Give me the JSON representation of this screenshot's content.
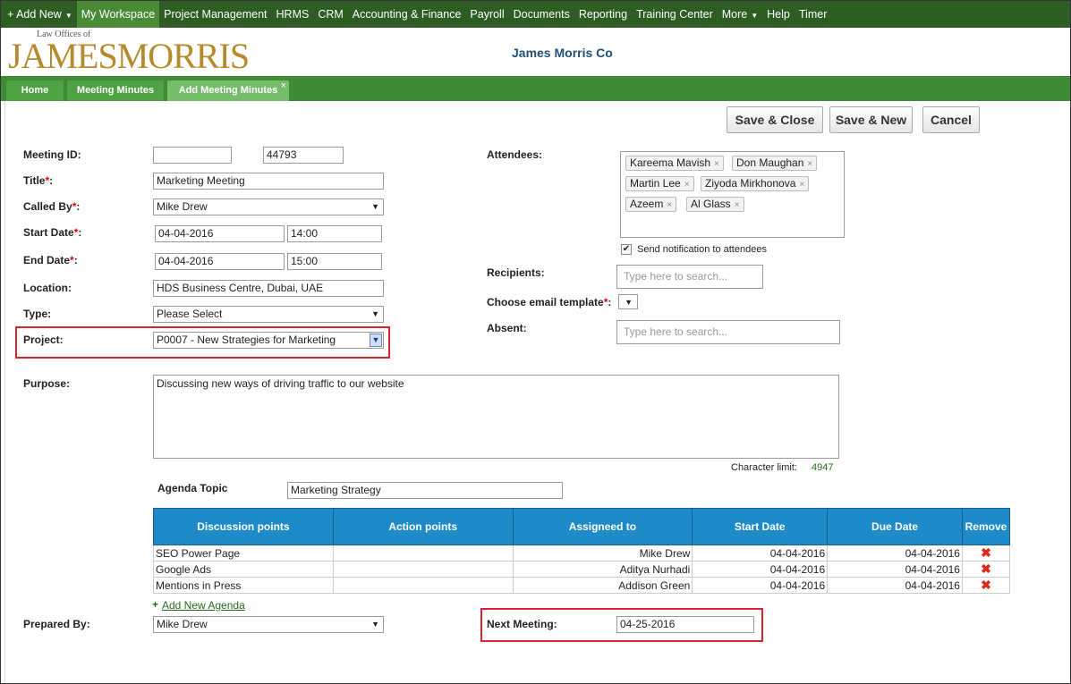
{
  "topnav": {
    "add_new": "+ Add New",
    "items": [
      "My Workspace",
      "Project Management",
      "HRMS",
      "CRM",
      "Accounting & Finance",
      "Payroll",
      "Documents",
      "Reporting",
      "Training Center"
    ],
    "more": "More",
    "help": "Help",
    "timer": "Timer"
  },
  "header": {
    "logo_small": "Law Offices of",
    "logo_big": "JAMESMORRIS",
    "company": "James Morris Co"
  },
  "tabs": [
    "Home",
    "Meeting Minutes",
    "Add Meeting Minutes"
  ],
  "tab_close": "×",
  "actions": {
    "save_close": "Save & Close",
    "save_new": "Save & New",
    "cancel": "Cancel"
  },
  "form": {
    "meeting_id_label": "Meeting ID:",
    "meeting_id_value": "",
    "meeting_id_number": "44793",
    "title_label": "Title",
    "title_value": "Marketing Meeting",
    "called_by_label": "Called By",
    "called_by_value": "Mike Drew",
    "start_date_label": "Start Date",
    "start_date_value": "04-04-2016",
    "start_time_value": "14:00",
    "end_date_label": "End Date",
    "end_date_value": "04-04-2016",
    "end_time_value": "15:00",
    "location_label": "Location:",
    "location_value": "HDS Business Centre, Dubai, UAE",
    "type_label": "Type:",
    "type_value": "Please Select",
    "project_label": "Project:",
    "project_value": "P0007 - New Strategies for Marketing",
    "purpose_label": "Purpose:",
    "purpose_value": "Discussing new ways of driving traffic to our website",
    "char_limit_label": "Character limit:",
    "char_limit_value": "4947",
    "agenda_topic_label": "Agenda Topic",
    "agenda_topic_value": "Marketing Strategy",
    "prepared_by_label": "Prepared By:",
    "prepared_by_value": "Mike Drew",
    "next_meeting_label": "Next Meeting:",
    "next_meeting_value": "04-25-2016",
    "required_mark": "*",
    "colon": ":"
  },
  "right": {
    "attendees_label": "Attendees:",
    "attendees": [
      "Kareema Mavish",
      "Don Maughan",
      "Martin Lee",
      "Ziyoda Mirkhonova",
      "Azeem",
      "Al Glass"
    ],
    "tag_remove": "×",
    "send_notification": "Send notification to attendees",
    "checkbox_mark": "✔",
    "recipients_label": "Recipients:",
    "recipients_placeholder": "Type here to search...",
    "email_template_label": "Choose email template",
    "absent_label": "Absent:",
    "absent_placeholder": "Type here to search..."
  },
  "agenda": {
    "headers": [
      "Discussion points",
      "Action points",
      "Assigneed to",
      "Start Date",
      "Due Date",
      "Remove"
    ],
    "rows": [
      {
        "discussion": "SEO Power Page",
        "action": "",
        "assigned": "Mike Drew",
        "start": "04-04-2016",
        "due": "04-04-2016"
      },
      {
        "discussion": "Google Ads",
        "action": "",
        "assigned": "Aditya Nurhadi",
        "start": "04-04-2016",
        "due": "04-04-2016"
      },
      {
        "discussion": "Mentions in Press",
        "action": "",
        "assigned": "Addison Green",
        "start": "04-04-2016",
        "due": "04-04-2016"
      }
    ],
    "remove_glyph": "✖",
    "add_new_plus": "+",
    "add_new_label": "Add New Agenda"
  },
  "colors": {
    "nav_bg": "#2e5d23",
    "tab_bar": "#3f8a35",
    "table_header": "#1f8ac9",
    "highlight": "#d9232d",
    "logo_gold": "#b58a2c",
    "company_blue": "#1f4e79"
  }
}
